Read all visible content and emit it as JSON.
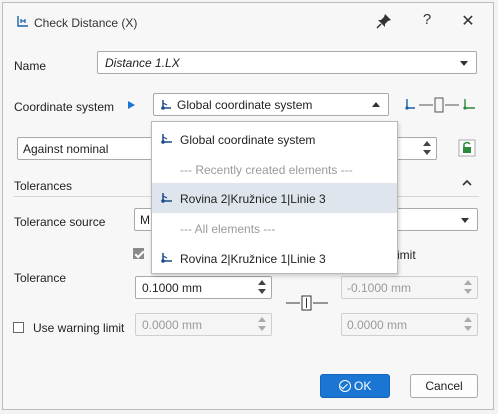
{
  "window": {
    "title": "Check Distance (X)",
    "help_label": "?",
    "close_label": "✕"
  },
  "name": {
    "label": "Name",
    "value": "Distance 1.LX"
  },
  "coordinate_system": {
    "label": "Coordinate system",
    "value": "Global coordinate system"
  },
  "against": {
    "value": "Against nominal"
  },
  "tolerances": {
    "header": "Tolerances",
    "source_label": "Tolerance source",
    "source_value": "M",
    "symmetric_label_fragment": "imit",
    "tolerance_label": "Tolerance",
    "upper_value": "0.1000 mm",
    "lower_value": "-0.1000 mm",
    "warning_label": "Use warning limit",
    "warning_upper": "0.0000 mm",
    "warning_lower": "0.0000 mm"
  },
  "dropdown": {
    "items": [
      {
        "label": "Global coordinate system",
        "icon": "coordinate-system-icon",
        "kind": "item"
      },
      {
        "label": "--- Recently created elements ---",
        "kind": "separator"
      },
      {
        "label": "Rovina 2|Kružnice 1|Linie 3",
        "icon": "coordinate-system-icon",
        "kind": "item",
        "selected": true
      },
      {
        "label": "--- All elements ---",
        "kind": "separator"
      },
      {
        "label": "Rovina 2|Kružnice 1|Linie 3",
        "icon": "coordinate-system-icon",
        "kind": "item"
      }
    ]
  },
  "buttons": {
    "ok": "OK",
    "cancel": "Cancel"
  },
  "colors": {
    "accent": "#1b76d3",
    "selected_row": "#dfe5ec",
    "icon_blue": "#1b5fa8",
    "icon_green": "#2e8b3a"
  }
}
